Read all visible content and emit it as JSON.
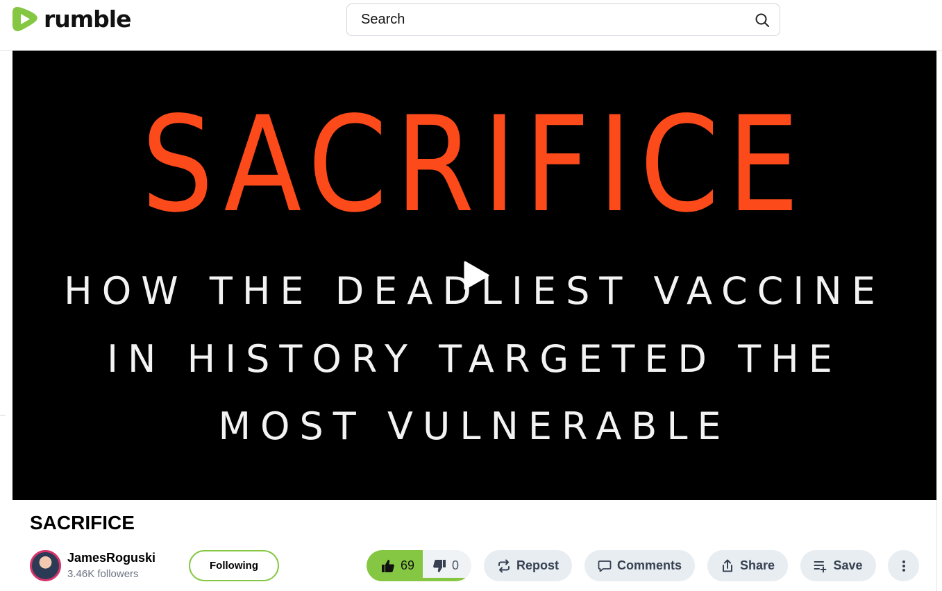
{
  "header": {
    "logo_text": "rumble",
    "search_placeholder": "Search"
  },
  "player": {
    "thumbnail_title": "SACRIFICE",
    "thumbnail_line1": "HOW THE DEADLIEST VACCINE",
    "thumbnail_line2": "IN HISTORY TARGETED THE",
    "thumbnail_line3": "MOST VULNERABLE"
  },
  "video": {
    "title": "SACRIFICE",
    "channel_name": "JamesRoguski",
    "followers": "3.46K followers",
    "follow_label": "Following"
  },
  "actions": {
    "likes": "69",
    "dislikes": "0",
    "repost_label": "Repost",
    "comments_label": "Comments",
    "share_label": "Share",
    "save_label": "Save"
  },
  "colors": {
    "brand_green": "#85c742",
    "thumb_title": "#fc4a1a"
  }
}
